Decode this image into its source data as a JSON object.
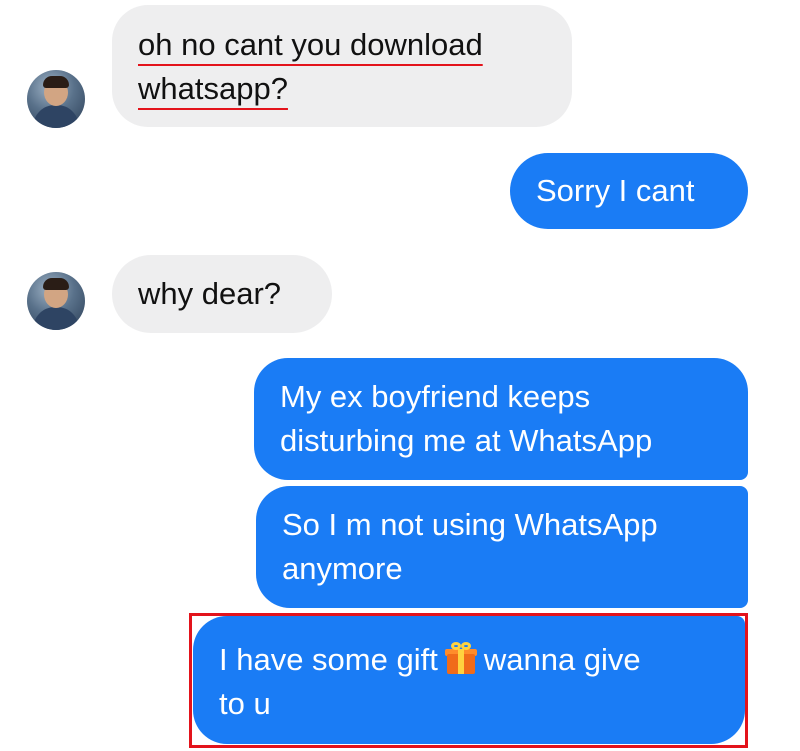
{
  "messages": [
    {
      "direction": "incoming",
      "line1": "oh no cant you download",
      "line2": "whatsapp?"
    },
    {
      "direction": "outgoing",
      "text": "Sorry I cant"
    },
    {
      "direction": "incoming",
      "text": "why dear?"
    },
    {
      "direction": "outgoing",
      "line1": "My ex boyfriend keeps",
      "line2": "disturbing me at WhatsApp"
    },
    {
      "direction": "outgoing",
      "line1": "So I m not using WhatsApp",
      "line2": "anymore"
    },
    {
      "direction": "outgoing",
      "line1_before": "I have some gift",
      "emoji": "gift-icon",
      "line1_after": "wanna give",
      "line2": "to u"
    }
  ],
  "colors": {
    "incoming_bubble": "#eeeeef",
    "outgoing_bubble": "#1a7cf5",
    "annotation_red": "#e3131b"
  }
}
